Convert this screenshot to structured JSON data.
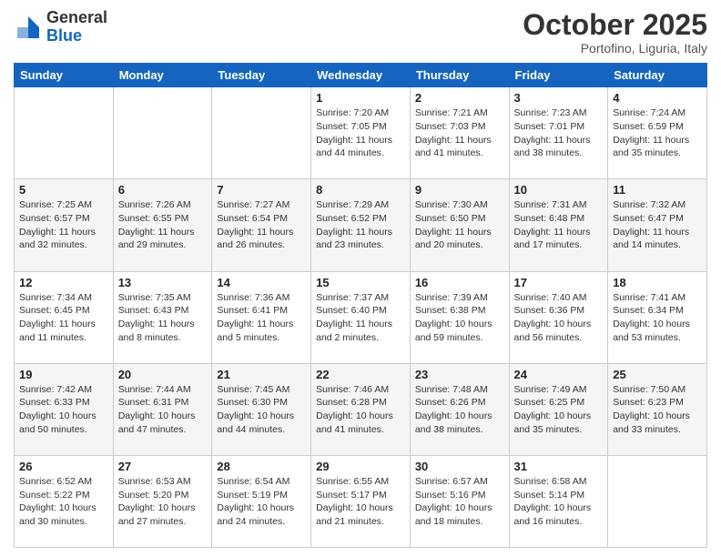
{
  "logo": {
    "general": "General",
    "blue": "Blue"
  },
  "header": {
    "month": "October 2025",
    "location": "Portofino, Liguria, Italy"
  },
  "weekdays": [
    "Sunday",
    "Monday",
    "Tuesday",
    "Wednesday",
    "Thursday",
    "Friday",
    "Saturday"
  ],
  "weeks": [
    [
      {
        "day": "",
        "sunrise": "",
        "sunset": "",
        "daylight": ""
      },
      {
        "day": "",
        "sunrise": "",
        "sunset": "",
        "daylight": ""
      },
      {
        "day": "",
        "sunrise": "",
        "sunset": "",
        "daylight": ""
      },
      {
        "day": "1",
        "sunrise": "Sunrise: 7:20 AM",
        "sunset": "Sunset: 7:05 PM",
        "daylight": "Daylight: 11 hours and 44 minutes."
      },
      {
        "day": "2",
        "sunrise": "Sunrise: 7:21 AM",
        "sunset": "Sunset: 7:03 PM",
        "daylight": "Daylight: 11 hours and 41 minutes."
      },
      {
        "day": "3",
        "sunrise": "Sunrise: 7:23 AM",
        "sunset": "Sunset: 7:01 PM",
        "daylight": "Daylight: 11 hours and 38 minutes."
      },
      {
        "day": "4",
        "sunrise": "Sunrise: 7:24 AM",
        "sunset": "Sunset: 6:59 PM",
        "daylight": "Daylight: 11 hours and 35 minutes."
      }
    ],
    [
      {
        "day": "5",
        "sunrise": "Sunrise: 7:25 AM",
        "sunset": "Sunset: 6:57 PM",
        "daylight": "Daylight: 11 hours and 32 minutes."
      },
      {
        "day": "6",
        "sunrise": "Sunrise: 7:26 AM",
        "sunset": "Sunset: 6:55 PM",
        "daylight": "Daylight: 11 hours and 29 minutes."
      },
      {
        "day": "7",
        "sunrise": "Sunrise: 7:27 AM",
        "sunset": "Sunset: 6:54 PM",
        "daylight": "Daylight: 11 hours and 26 minutes."
      },
      {
        "day": "8",
        "sunrise": "Sunrise: 7:29 AM",
        "sunset": "Sunset: 6:52 PM",
        "daylight": "Daylight: 11 hours and 23 minutes."
      },
      {
        "day": "9",
        "sunrise": "Sunrise: 7:30 AM",
        "sunset": "Sunset: 6:50 PM",
        "daylight": "Daylight: 11 hours and 20 minutes."
      },
      {
        "day": "10",
        "sunrise": "Sunrise: 7:31 AM",
        "sunset": "Sunset: 6:48 PM",
        "daylight": "Daylight: 11 hours and 17 minutes."
      },
      {
        "day": "11",
        "sunrise": "Sunrise: 7:32 AM",
        "sunset": "Sunset: 6:47 PM",
        "daylight": "Daylight: 11 hours and 14 minutes."
      }
    ],
    [
      {
        "day": "12",
        "sunrise": "Sunrise: 7:34 AM",
        "sunset": "Sunset: 6:45 PM",
        "daylight": "Daylight: 11 hours and 11 minutes."
      },
      {
        "day": "13",
        "sunrise": "Sunrise: 7:35 AM",
        "sunset": "Sunset: 6:43 PM",
        "daylight": "Daylight: 11 hours and 8 minutes."
      },
      {
        "day": "14",
        "sunrise": "Sunrise: 7:36 AM",
        "sunset": "Sunset: 6:41 PM",
        "daylight": "Daylight: 11 hours and 5 minutes."
      },
      {
        "day": "15",
        "sunrise": "Sunrise: 7:37 AM",
        "sunset": "Sunset: 6:40 PM",
        "daylight": "Daylight: 11 hours and 2 minutes."
      },
      {
        "day": "16",
        "sunrise": "Sunrise: 7:39 AM",
        "sunset": "Sunset: 6:38 PM",
        "daylight": "Daylight: 10 hours and 59 minutes."
      },
      {
        "day": "17",
        "sunrise": "Sunrise: 7:40 AM",
        "sunset": "Sunset: 6:36 PM",
        "daylight": "Daylight: 10 hours and 56 minutes."
      },
      {
        "day": "18",
        "sunrise": "Sunrise: 7:41 AM",
        "sunset": "Sunset: 6:34 PM",
        "daylight": "Daylight: 10 hours and 53 minutes."
      }
    ],
    [
      {
        "day": "19",
        "sunrise": "Sunrise: 7:42 AM",
        "sunset": "Sunset: 6:33 PM",
        "daylight": "Daylight: 10 hours and 50 minutes."
      },
      {
        "day": "20",
        "sunrise": "Sunrise: 7:44 AM",
        "sunset": "Sunset: 6:31 PM",
        "daylight": "Daylight: 10 hours and 47 minutes."
      },
      {
        "day": "21",
        "sunrise": "Sunrise: 7:45 AM",
        "sunset": "Sunset: 6:30 PM",
        "daylight": "Daylight: 10 hours and 44 minutes."
      },
      {
        "day": "22",
        "sunrise": "Sunrise: 7:46 AM",
        "sunset": "Sunset: 6:28 PM",
        "daylight": "Daylight: 10 hours and 41 minutes."
      },
      {
        "day": "23",
        "sunrise": "Sunrise: 7:48 AM",
        "sunset": "Sunset: 6:26 PM",
        "daylight": "Daylight: 10 hours and 38 minutes."
      },
      {
        "day": "24",
        "sunrise": "Sunrise: 7:49 AM",
        "sunset": "Sunset: 6:25 PM",
        "daylight": "Daylight: 10 hours and 35 minutes."
      },
      {
        "day": "25",
        "sunrise": "Sunrise: 7:50 AM",
        "sunset": "Sunset: 6:23 PM",
        "daylight": "Daylight: 10 hours and 33 minutes."
      }
    ],
    [
      {
        "day": "26",
        "sunrise": "Sunrise: 6:52 AM",
        "sunset": "Sunset: 5:22 PM",
        "daylight": "Daylight: 10 hours and 30 minutes."
      },
      {
        "day": "27",
        "sunrise": "Sunrise: 6:53 AM",
        "sunset": "Sunset: 5:20 PM",
        "daylight": "Daylight: 10 hours and 27 minutes."
      },
      {
        "day": "28",
        "sunrise": "Sunrise: 6:54 AM",
        "sunset": "Sunset: 5:19 PM",
        "daylight": "Daylight: 10 hours and 24 minutes."
      },
      {
        "day": "29",
        "sunrise": "Sunrise: 6:55 AM",
        "sunset": "Sunset: 5:17 PM",
        "daylight": "Daylight: 10 hours and 21 minutes."
      },
      {
        "day": "30",
        "sunrise": "Sunrise: 6:57 AM",
        "sunset": "Sunset: 5:16 PM",
        "daylight": "Daylight: 10 hours and 18 minutes."
      },
      {
        "day": "31",
        "sunrise": "Sunrise: 6:58 AM",
        "sunset": "Sunset: 5:14 PM",
        "daylight": "Daylight: 10 hours and 16 minutes."
      },
      {
        "day": "",
        "sunrise": "",
        "sunset": "",
        "daylight": ""
      }
    ]
  ]
}
